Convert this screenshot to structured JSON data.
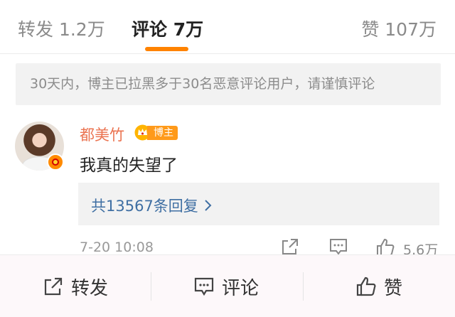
{
  "tabs": {
    "repost": "转发 1.2万",
    "comment": "评论 7万",
    "like": "赞 107万",
    "accent_color": "#ff8200"
  },
  "notice": "30天内，博主已拉黑多于30名恶意评论用户，请谨慎评论",
  "comment": {
    "username": "都美竹",
    "author_badge": "博主",
    "text": "我真的失望了",
    "replies_link": "共13567条回复",
    "time": "7-20 10:08",
    "like_count": "5.6万",
    "avatar_icon": "avatar",
    "verified_icon": "verified-badge-icon"
  },
  "bottom_bar": {
    "repost": "转发",
    "comment": "评论",
    "like": "赞"
  },
  "colors": {
    "username": "#eb7350",
    "link": "#3f6fa3",
    "badge": "#ff9a1a"
  }
}
